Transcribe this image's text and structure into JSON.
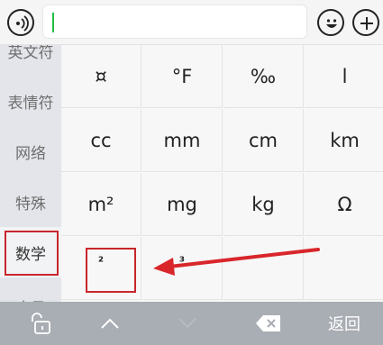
{
  "input": {
    "value": ""
  },
  "sidebar": {
    "items": [
      {
        "label": "英文符"
      },
      {
        "label": "表情符"
      },
      {
        "label": "网络"
      },
      {
        "label": "特殊"
      },
      {
        "label": "数学"
      },
      {
        "label": "序号"
      }
    ],
    "selected": "数学"
  },
  "grid": {
    "rows": [
      [
        "¤",
        "°F",
        "‰",
        "l"
      ],
      [
        "cc",
        "mm",
        "cm",
        "km"
      ],
      [
        "m²",
        "mg",
        "kg",
        "Ω"
      ],
      [
        "²",
        "³",
        "",
        ""
      ]
    ]
  },
  "bottom_bar": {
    "back_label": "返回",
    "icons": [
      "lock-icon",
      "chevron-up-icon",
      "chevron-down-icon",
      "backspace-icon"
    ]
  },
  "icons": {
    "voice": "voice-icon",
    "emoji": "emoji-icon",
    "plus": "plus-icon"
  },
  "colors": {
    "highlight": "#c8262c",
    "caret": "#1fbf43",
    "bottom_bar": "#a9adb4",
    "sidebar": "#e3e5ea"
  }
}
